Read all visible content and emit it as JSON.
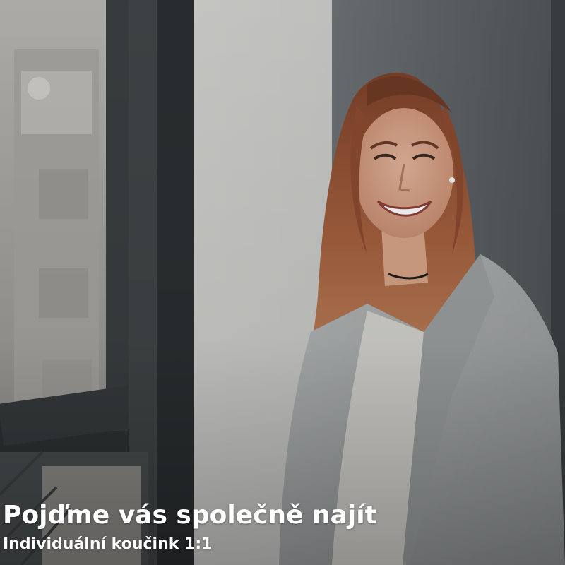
{
  "hero": {
    "title": "Pojďme vás společně najít",
    "subtitle": "Individuální koučink 1:1"
  },
  "photo": {
    "subject": "smiling-woman-by-window",
    "colors": {
      "wall": "#c9c9c6",
      "window_frame": "#35393b",
      "hair": "#9a5a3a",
      "jacket": "#a9adae",
      "shirt": "#d7d6d1"
    }
  }
}
